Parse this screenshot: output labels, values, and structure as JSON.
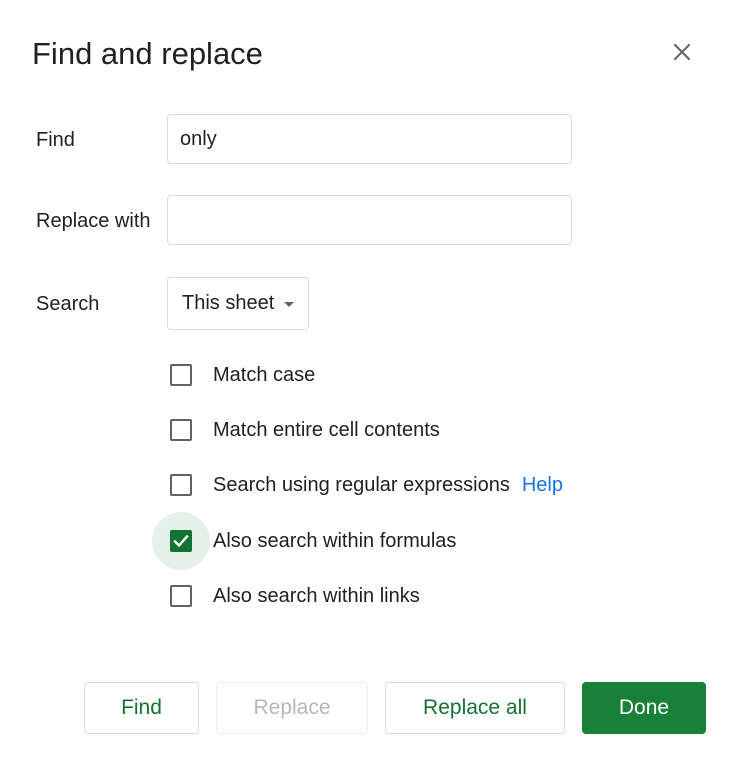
{
  "dialog": {
    "title": "Find and replace",
    "close_icon": "close-icon"
  },
  "fields": {
    "find_label": "Find",
    "find_value": "only",
    "replace_label": "Replace with",
    "replace_value": "",
    "search_label": "Search",
    "search_selected": "This sheet"
  },
  "options": [
    {
      "label": "Match case",
      "checked": false
    },
    {
      "label": "Match entire cell contents",
      "checked": false
    },
    {
      "label": "Search using regular expressions",
      "checked": false,
      "link": "Help"
    },
    {
      "label": "Also search within formulas",
      "checked": true
    },
    {
      "label": "Also search within links",
      "checked": false
    }
  ],
  "buttons": {
    "find": "Find",
    "replace": "Replace",
    "replace_all": "Replace all",
    "done": "Done"
  },
  "colors": {
    "accent": "#188038",
    "link": "#1a73e8",
    "disabled": "#b4b8bc"
  }
}
